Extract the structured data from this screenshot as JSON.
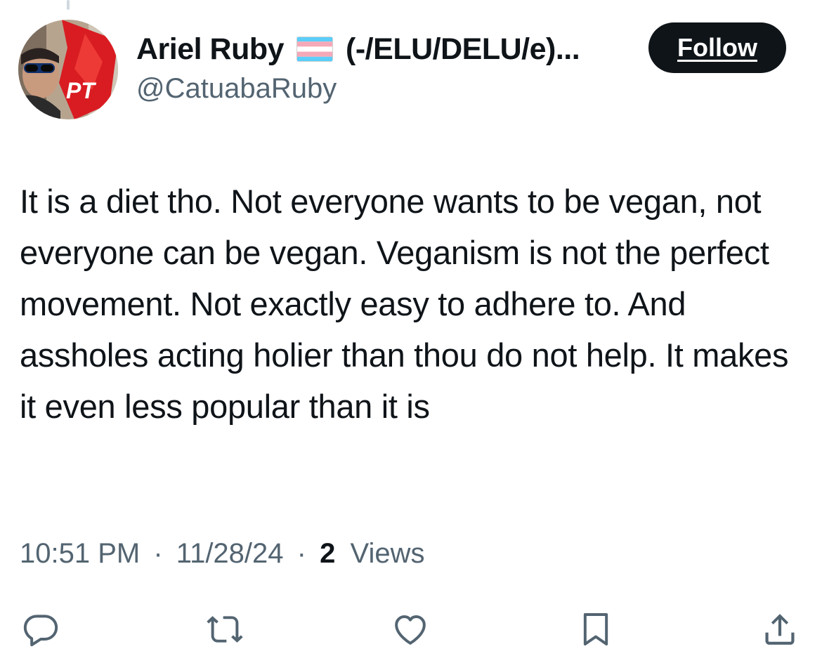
{
  "author": {
    "display_name": "Ariel Ruby",
    "flag_icon": "transgender-flag-icon",
    "name_suffix": "(-/ELU/DELU/e)...",
    "handle": "@CatuabaRuby",
    "avatar_badge_text": "PT"
  },
  "follow_button": {
    "label": "Follow"
  },
  "tweet": {
    "text": "It is a diet tho. Not everyone wants to be vegan, not everyone can be vegan. Veganism is not the perfect movement. Not exactly easy to adhere to. And assholes acting holier than thou do not help. It makes it even less popular than it is"
  },
  "meta": {
    "time": "10:51 PM",
    "separator": "·",
    "date": "11/28/24",
    "views_count": "2",
    "views_label": "Views"
  },
  "actions": [
    {
      "icon": "reply-icon"
    },
    {
      "icon": "retweet-icon"
    },
    {
      "icon": "like-icon"
    },
    {
      "icon": "bookmark-icon"
    },
    {
      "icon": "share-icon"
    }
  ],
  "colors": {
    "text_primary": "#0f1419",
    "text_secondary": "#536471",
    "action_icon": "#536471",
    "follow_bg": "#0f1419",
    "follow_text": "#ffffff"
  }
}
